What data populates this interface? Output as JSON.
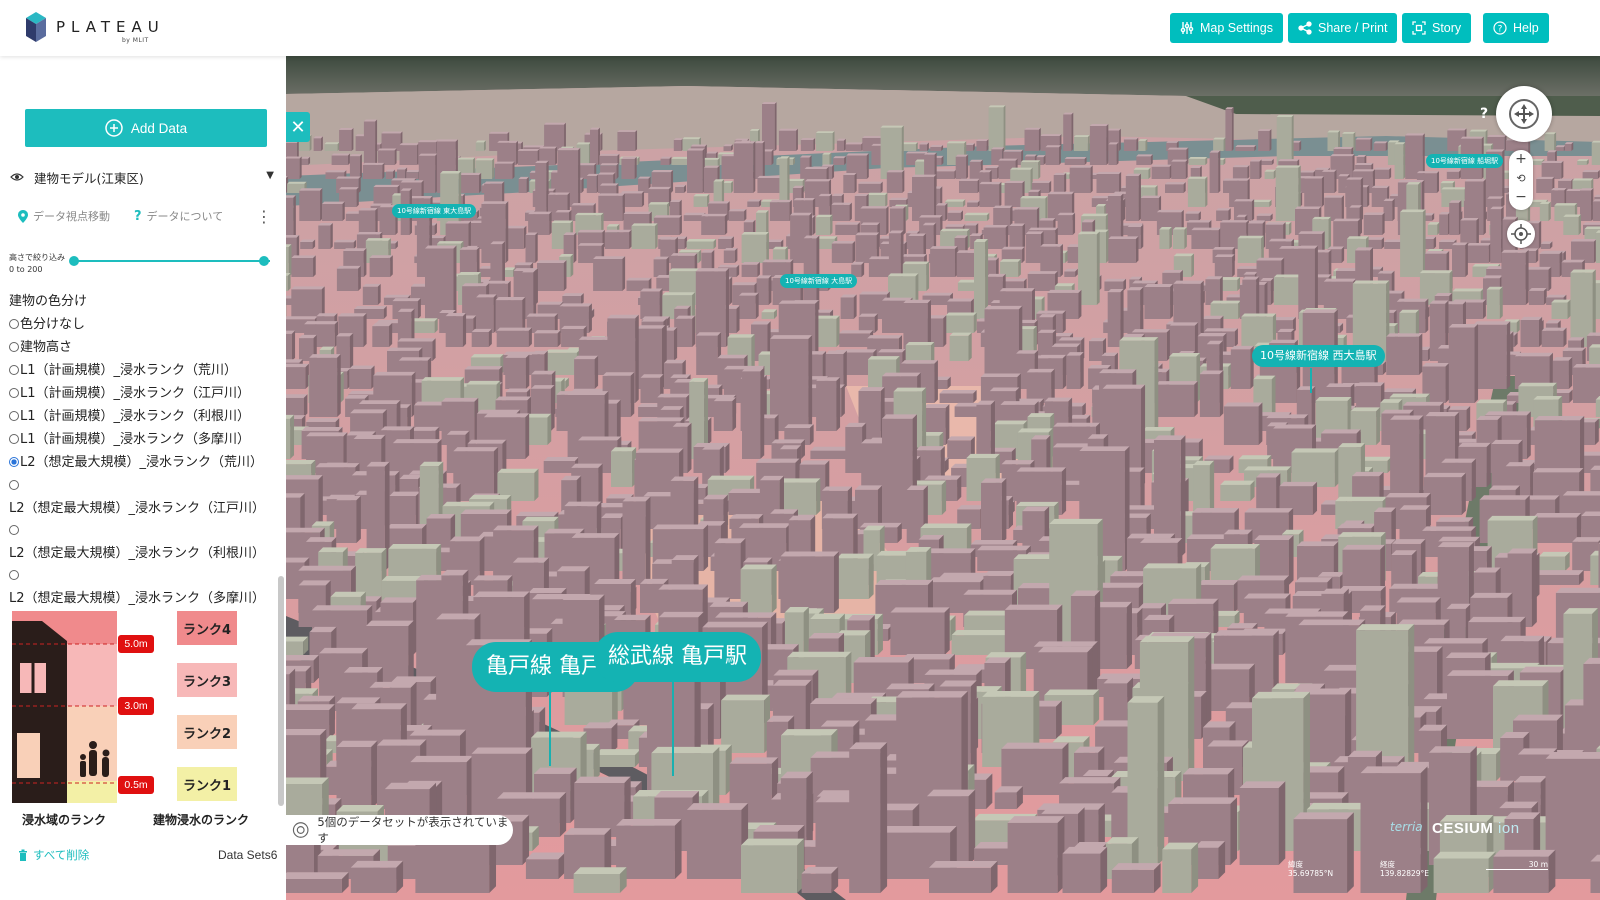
{
  "app": {
    "logo_text": "PLATEAU",
    "logo_sub": "by MLIT"
  },
  "header": {
    "buttons": [
      {
        "label": "Map Settings",
        "icon": "sliders-icon"
      },
      {
        "label": "Share / Print",
        "icon": "share-icon"
      },
      {
        "label": "Story",
        "icon": "story-icon"
      },
      {
        "label": "Help",
        "icon": "help-icon"
      }
    ]
  },
  "sidebar": {
    "add_data_label": "Add Data",
    "layer_name": "建物モデル(江東区)",
    "actions": {
      "move_to_data": "データ視点移動",
      "about_data": "データについて"
    },
    "height_filter": {
      "label": "高さで絞り込み",
      "range": "0 to 200",
      "min": 0,
      "max": 200
    },
    "coloring_title": "建物の色分け",
    "options": [
      {
        "label": "色分けなし",
        "selected": false
      },
      {
        "label": "建物高さ",
        "selected": false
      },
      {
        "label": "L1（計画規模）_浸水ランク（荒川）",
        "selected": false
      },
      {
        "label": "L1（計画規模）_浸水ランク（江戸川）",
        "selected": false
      },
      {
        "label": "L1（計画規模）_浸水ランク（利根川）",
        "selected": false
      },
      {
        "label": "L1（計画規模）_浸水ランク（多摩川）",
        "selected": false
      },
      {
        "label": "L2（想定最大規模）_浸水ランク（荒川）",
        "selected": true
      },
      {
        "label": "L2（想定最大規模）_浸水ランク（江戸川）",
        "selected": false
      },
      {
        "label": "L2（想定最大規模）_浸水ランク（利根川）",
        "selected": false
      },
      {
        "label": "L2（想定最大規模）_浸水ランク（多摩川）",
        "selected": false
      }
    ],
    "legend": {
      "depths": [
        "5.0m",
        "3.0m",
        "0.5m"
      ],
      "ranks": [
        {
          "label": "ランク4",
          "color": "#f08a8c"
        },
        {
          "label": "ランク3",
          "color": "#f7b8b8"
        },
        {
          "label": "ランク2",
          "color": "#f9d0b8"
        },
        {
          "label": "ランク1",
          "color": "#f3f0a6"
        }
      ],
      "caption_area": "浸水域のランク",
      "caption_building": "建物浸水のランク"
    },
    "delete_all": "すべて削除",
    "datasets_label": "Data Sets6"
  },
  "map": {
    "stations": [
      {
        "label": "亀戸線 亀戸駅",
        "size": "big"
      },
      {
        "label": "総武線 亀戸駅",
        "size": "big"
      },
      {
        "label": "10号線新宿線 西大島駅",
        "size": "mid"
      },
      {
        "label": "10号線新宿線 大島駅",
        "size": "small"
      },
      {
        "label": "10号線新宿線 東大島駅",
        "size": "small"
      },
      {
        "label": "10号線新宿線 船堀駅",
        "size": "small"
      }
    ],
    "status_text": "5個のデータセットが表示されています",
    "credits": {
      "cesium": "CESIUM",
      "ion": "ion",
      "terria": "terria"
    },
    "coords": {
      "lat_label": "緯度",
      "lat_value": "35.69785°N",
      "lon_label": "経度",
      "lon_value": "139.82829°E"
    },
    "scale_label": "30 m"
  },
  "colors": {
    "accent": "#1dbdbe",
    "building": "#a8878e",
    "flood": "#e8999c"
  }
}
